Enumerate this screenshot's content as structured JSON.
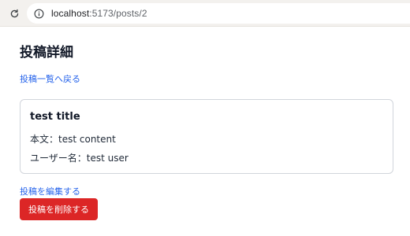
{
  "browser": {
    "url_host": "localhost",
    "url_path": ":5173/posts/2",
    "reload_icon": "reload-icon",
    "site_info_icon": "info-icon"
  },
  "page": {
    "title": "投稿詳細",
    "back_link": "投稿一覧へ戻る",
    "post": {
      "title": "test title",
      "content_label": "本文：",
      "content_value": "test content",
      "user_label": "ユーザー名：",
      "user_value": "test user"
    },
    "edit_link": "投稿を編集する",
    "delete_button": "投稿を削除する"
  },
  "colors": {
    "link": "#2563eb",
    "danger": "#dc2626",
    "browser_bar": "#f3f1ee",
    "card_border": "#d1d5db"
  }
}
